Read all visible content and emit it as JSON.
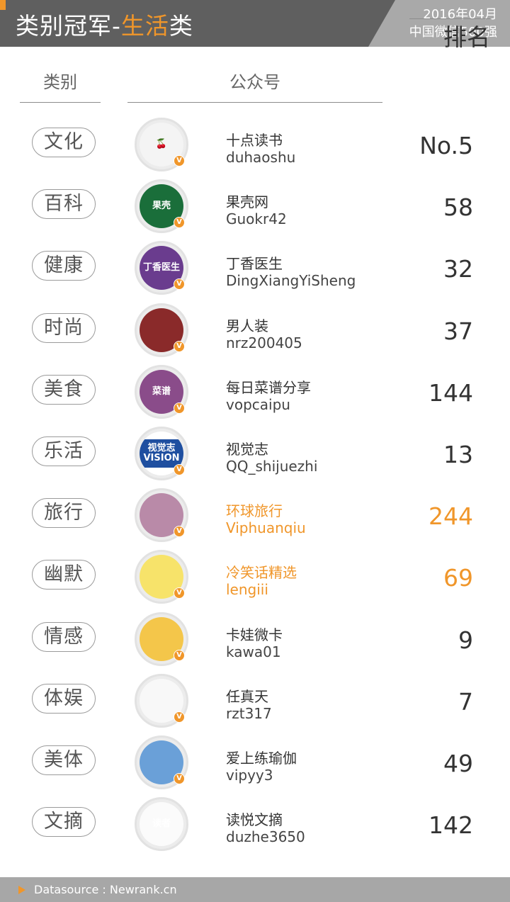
{
  "header": {
    "title_main": "类别冠军-",
    "title_highlight": "生活",
    "title_tail": "类",
    "date": "2016年04月",
    "subtitle": "中国微信500强",
    "accent_color": "#f0962a"
  },
  "columns": {
    "category": "类别",
    "account": "公众号",
    "rank": "排名"
  },
  "rows": [
    {
      "category": "文化",
      "name": "十点读书",
      "id": "duhaoshu",
      "rank": "No.5",
      "avatar_text": "🍒",
      "highlight": false
    },
    {
      "category": "百科",
      "name": "果壳网",
      "id": "Guokr42",
      "rank": "58",
      "avatar_text": "果壳",
      "highlight": false
    },
    {
      "category": "健康",
      "name": "丁香医生",
      "id": "DingXiangYiSheng",
      "rank": "32",
      "avatar_text": "丁香医生",
      "highlight": false
    },
    {
      "category": "时尚",
      "name": "男人装",
      "id": "nrz200405",
      "rank": "37",
      "avatar_text": "",
      "highlight": false
    },
    {
      "category": "美食",
      "name": "每日菜谱分享",
      "id": "vopcaipu",
      "rank": "144",
      "avatar_text": "菜谱",
      "highlight": false
    },
    {
      "category": "乐活",
      "name": "视觉志",
      "id": "QQ_shijuezhi",
      "rank": "13",
      "avatar_text": "视觉志 VISION",
      "highlight": false
    },
    {
      "category": "旅行",
      "name": "环球旅行",
      "id": "Viphuanqiu",
      "rank": "244",
      "avatar_text": "",
      "highlight": true
    },
    {
      "category": "幽默",
      "name": "冷笑话精选",
      "id": "lengiii",
      "rank": "69",
      "avatar_text": "",
      "highlight": true
    },
    {
      "category": "情感",
      "name": "卡娃微卡",
      "id": "kawa01",
      "rank": "9",
      "avatar_text": "",
      "highlight": false
    },
    {
      "category": "体娱",
      "name": "任真天",
      "id": "rzt317",
      "rank": "7",
      "avatar_text": "",
      "highlight": false
    },
    {
      "category": "美体",
      "name": "爱上练瑜伽",
      "id": "vipyy3",
      "rank": "49",
      "avatar_text": "",
      "highlight": false
    },
    {
      "category": "文摘",
      "name": "读悦文摘",
      "id": "duzhe3650",
      "rank": "142",
      "avatar_text": "读者",
      "highlight": false
    }
  ],
  "verified_badge": "V",
  "footer": {
    "source": "Datasource : Newrank.cn"
  }
}
